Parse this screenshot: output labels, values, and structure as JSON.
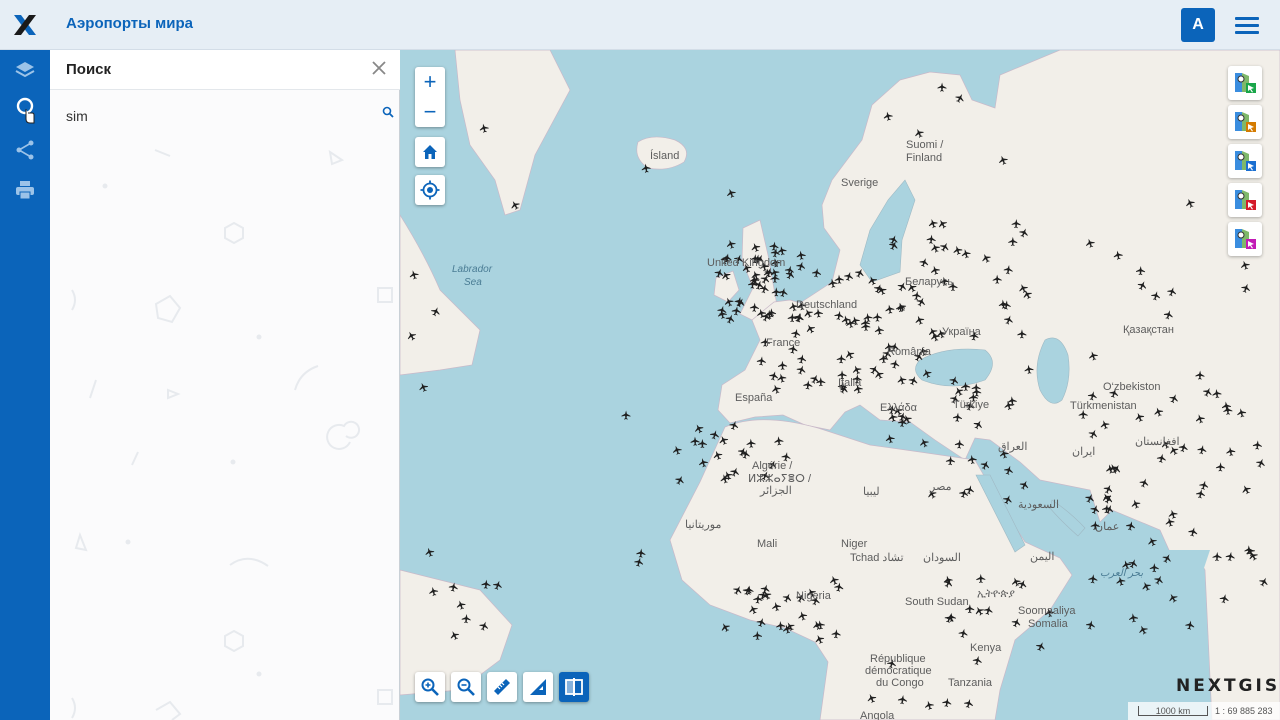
{
  "header": {
    "title": "Аэропорты мира",
    "avatar_letter": "A",
    "logo_icon": "nextgis-x-logo",
    "menu_icon": "hamburger-menu-icon"
  },
  "sidebar": {
    "items": [
      {
        "name": "layers",
        "icon": "layers-icon"
      },
      {
        "name": "search",
        "icon": "search-icon",
        "active": true
      },
      {
        "name": "share",
        "icon": "share-icon"
      },
      {
        "name": "print",
        "icon": "print-icon"
      }
    ]
  },
  "search_panel": {
    "title": "Поиск",
    "query": "sim"
  },
  "map": {
    "zoom_in_label": "+",
    "zoom_out_label": "−",
    "labels": {
      "island": "Ísland",
      "sverige": "Sverige",
      "suomi": "Suomi /",
      "finland": "Finland",
      "uk": "United Kingdom",
      "deutschland": "Deutschland",
      "belarus": "Беларусь",
      "ukraina": "Україна",
      "kazakhstan": "Қазақстан",
      "france": "France",
      "romania": "România",
      "ozbekiston": "O‘zbekiston",
      "turkmenistan": "Türkmenistan",
      "espana": "España",
      "italia": "Italia",
      "ellada": "Ελλάδα",
      "turkiye": "Türkiye",
      "iraq": "العراق",
      "iran": "ایران",
      "afghanistan": "افغانستان",
      "algerie_1": "Algérie /",
      "algerie_2": "ⵍⵣⵣⴰⵢⴻⵔ /",
      "algerie_3": "الجزائر",
      "libya": "ليبيا",
      "egypt": "مصر",
      "saudi": "السعودية",
      "oman": "عمان",
      "mauritania": "موريتانيا",
      "mali": "Mali",
      "niger": "Niger",
      "tchad": "Tchad تشاد",
      "sudan": "السودان",
      "yemen": "اليمن",
      "nigeria": "Nigeria",
      "south_sudan": "South Sudan",
      "ethiopia": "ኢትዮጵያ",
      "somaliya": "Soomaaliya",
      "somalia": "Somalia",
      "rca_1": "République",
      "rca_2": "démocratique",
      "rca_3": "du Congo",
      "kenya": "Kenya",
      "tanzania": "Tanzania",
      "angola": "Angola",
      "labrador": "Labrador",
      "sea": "Sea",
      "arabian_sea": "بحر العرب"
    },
    "layer_colors": [
      "#1aa64a",
      "#d47b00",
      "#1a6fd1",
      "#d41a2a",
      "#c21ab5"
    ],
    "brand": "NEXTGIS",
    "scale_distance": "1000 km",
    "scale_ratio": "1 : 69 885 283"
  },
  "colors": {
    "accent": "#0b64ba",
    "water": "#aad3df",
    "land": "#f2efe9"
  }
}
